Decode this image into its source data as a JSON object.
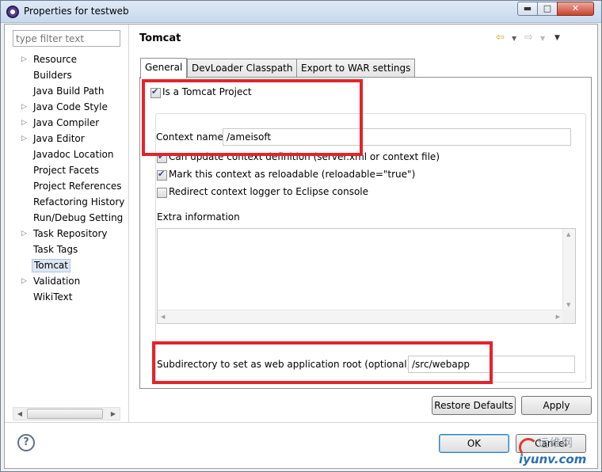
{
  "window": {
    "title": "Properties for testweb"
  },
  "sidebar": {
    "filter_placeholder": "type filter text",
    "items": [
      {
        "label": "Resource",
        "arrow": "▷"
      },
      {
        "label": "Builders",
        "arrow": ""
      },
      {
        "label": "Java Build Path",
        "arrow": ""
      },
      {
        "label": "Java Code Style",
        "arrow": "▷"
      },
      {
        "label": "Java Compiler",
        "arrow": "▷"
      },
      {
        "label": "Java Editor",
        "arrow": "▷"
      },
      {
        "label": "Javadoc Location",
        "arrow": ""
      },
      {
        "label": "Project Facets",
        "arrow": ""
      },
      {
        "label": "Project References",
        "arrow": ""
      },
      {
        "label": "Refactoring History",
        "arrow": ""
      },
      {
        "label": "Run/Debug Setting",
        "arrow": ""
      },
      {
        "label": "Task Repository",
        "arrow": "▷"
      },
      {
        "label": "Task Tags",
        "arrow": ""
      },
      {
        "label": "Tomcat",
        "arrow": "",
        "selected": true
      },
      {
        "label": "Validation",
        "arrow": "▷"
      },
      {
        "label": "WikiText",
        "arrow": ""
      }
    ]
  },
  "page": {
    "title": "Tomcat",
    "tabs": [
      "General",
      "DevLoader Classpath",
      "Export to WAR settings"
    ],
    "is_tomcat_label": "Is a Tomcat Project",
    "context_name_label": "Context name",
    "context_name_value": "/ameisoft",
    "can_update_label": "Can update context definition (server.xml or context file)",
    "reloadable_label": "Mark this context as reloadable (reloadable=\"true\")",
    "redirect_label": "Redirect context logger to Eclipse console",
    "extra_info_label": "Extra information",
    "subdir_label": "Subdirectory to set as web application root (optional)",
    "subdir_value": "/src/webapp"
  },
  "checkboxes": {
    "is_tomcat": true,
    "can_update": true,
    "reloadable": true,
    "redirect": false
  },
  "buttons": {
    "restore_defaults": "Restore Defaults",
    "apply": "Apply",
    "ok": "OK",
    "cancel": "Cancel"
  },
  "watermark": {
    "line1": "运维网",
    "line2": "iyunv.com"
  },
  "colors": {
    "highlight_box": "#e3242b",
    "selection": "#dde6f3"
  }
}
